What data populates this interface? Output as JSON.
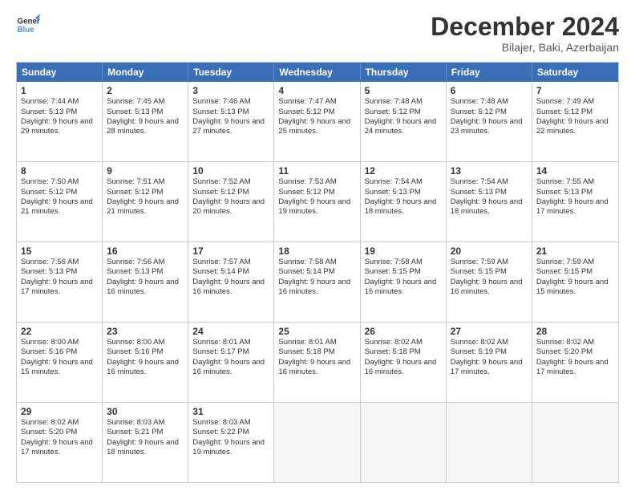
{
  "logo": {
    "general": "General",
    "blue": "Blue"
  },
  "title": "December 2024",
  "location": "Bilajer, Baki, Azerbaijan",
  "headers": [
    "Sunday",
    "Monday",
    "Tuesday",
    "Wednesday",
    "Thursday",
    "Friday",
    "Saturday"
  ],
  "weeks": [
    [
      {
        "day": "1",
        "sunrise": "Sunrise: 7:44 AM",
        "sunset": "Sunset: 5:13 PM",
        "daylight": "Daylight: 9 hours and 29 minutes."
      },
      {
        "day": "2",
        "sunrise": "Sunrise: 7:45 AM",
        "sunset": "Sunset: 5:13 PM",
        "daylight": "Daylight: 9 hours and 28 minutes."
      },
      {
        "day": "3",
        "sunrise": "Sunrise: 7:46 AM",
        "sunset": "Sunset: 5:13 PM",
        "daylight": "Daylight: 9 hours and 27 minutes."
      },
      {
        "day": "4",
        "sunrise": "Sunrise: 7:47 AM",
        "sunset": "Sunset: 5:12 PM",
        "daylight": "Daylight: 9 hours and 25 minutes."
      },
      {
        "day": "5",
        "sunrise": "Sunrise: 7:48 AM",
        "sunset": "Sunset: 5:12 PM",
        "daylight": "Daylight: 9 hours and 24 minutes."
      },
      {
        "day": "6",
        "sunrise": "Sunrise: 7:48 AM",
        "sunset": "Sunset: 5:12 PM",
        "daylight": "Daylight: 9 hours and 23 minutes."
      },
      {
        "day": "7",
        "sunrise": "Sunrise: 7:49 AM",
        "sunset": "Sunset: 5:12 PM",
        "daylight": "Daylight: 9 hours and 22 minutes."
      }
    ],
    [
      {
        "day": "8",
        "sunrise": "Sunrise: 7:50 AM",
        "sunset": "Sunset: 5:12 PM",
        "daylight": "Daylight: 9 hours and 21 minutes."
      },
      {
        "day": "9",
        "sunrise": "Sunrise: 7:51 AM",
        "sunset": "Sunset: 5:12 PM",
        "daylight": "Daylight: 9 hours and 21 minutes."
      },
      {
        "day": "10",
        "sunrise": "Sunrise: 7:52 AM",
        "sunset": "Sunset: 5:12 PM",
        "daylight": "Daylight: 9 hours and 20 minutes."
      },
      {
        "day": "11",
        "sunrise": "Sunrise: 7:53 AM",
        "sunset": "Sunset: 5:12 PM",
        "daylight": "Daylight: 9 hours and 19 minutes."
      },
      {
        "day": "12",
        "sunrise": "Sunrise: 7:54 AM",
        "sunset": "Sunset: 5:13 PM",
        "daylight": "Daylight: 9 hours and 18 minutes."
      },
      {
        "day": "13",
        "sunrise": "Sunrise: 7:54 AM",
        "sunset": "Sunset: 5:13 PM",
        "daylight": "Daylight: 9 hours and 18 minutes."
      },
      {
        "day": "14",
        "sunrise": "Sunrise: 7:55 AM",
        "sunset": "Sunset: 5:13 PM",
        "daylight": "Daylight: 9 hours and 17 minutes."
      }
    ],
    [
      {
        "day": "15",
        "sunrise": "Sunrise: 7:56 AM",
        "sunset": "Sunset: 5:13 PM",
        "daylight": "Daylight: 9 hours and 17 minutes."
      },
      {
        "day": "16",
        "sunrise": "Sunrise: 7:56 AM",
        "sunset": "Sunset: 5:13 PM",
        "daylight": "Daylight: 9 hours and 16 minutes."
      },
      {
        "day": "17",
        "sunrise": "Sunrise: 7:57 AM",
        "sunset": "Sunset: 5:14 PM",
        "daylight": "Daylight: 9 hours and 16 minutes."
      },
      {
        "day": "18",
        "sunrise": "Sunrise: 7:58 AM",
        "sunset": "Sunset: 5:14 PM",
        "daylight": "Daylight: 9 hours and 16 minutes."
      },
      {
        "day": "19",
        "sunrise": "Sunrise: 7:58 AM",
        "sunset": "Sunset: 5:15 PM",
        "daylight": "Daylight: 9 hours and 16 minutes."
      },
      {
        "day": "20",
        "sunrise": "Sunrise: 7:59 AM",
        "sunset": "Sunset: 5:15 PM",
        "daylight": "Daylight: 9 hours and 16 minutes."
      },
      {
        "day": "21",
        "sunrise": "Sunrise: 7:59 AM",
        "sunset": "Sunset: 5:15 PM",
        "daylight": "Daylight: 9 hours and 15 minutes."
      }
    ],
    [
      {
        "day": "22",
        "sunrise": "Sunrise: 8:00 AM",
        "sunset": "Sunset: 5:16 PM",
        "daylight": "Daylight: 9 hours and 15 minutes."
      },
      {
        "day": "23",
        "sunrise": "Sunrise: 8:00 AM",
        "sunset": "Sunset: 5:16 PM",
        "daylight": "Daylight: 9 hours and 16 minutes."
      },
      {
        "day": "24",
        "sunrise": "Sunrise: 8:01 AM",
        "sunset": "Sunset: 5:17 PM",
        "daylight": "Daylight: 9 hours and 16 minutes."
      },
      {
        "day": "25",
        "sunrise": "Sunrise: 8:01 AM",
        "sunset": "Sunset: 5:18 PM",
        "daylight": "Daylight: 9 hours and 16 minutes."
      },
      {
        "day": "26",
        "sunrise": "Sunrise: 8:02 AM",
        "sunset": "Sunset: 5:18 PM",
        "daylight": "Daylight: 9 hours and 16 minutes."
      },
      {
        "day": "27",
        "sunrise": "Sunrise: 8:02 AM",
        "sunset": "Sunset: 5:19 PM",
        "daylight": "Daylight: 9 hours and 17 minutes."
      },
      {
        "day": "28",
        "sunrise": "Sunrise: 8:02 AM",
        "sunset": "Sunset: 5:20 PM",
        "daylight": "Daylight: 9 hours and 17 minutes."
      }
    ],
    [
      {
        "day": "29",
        "sunrise": "Sunrise: 8:02 AM",
        "sunset": "Sunset: 5:20 PM",
        "daylight": "Daylight: 9 hours and 17 minutes."
      },
      {
        "day": "30",
        "sunrise": "Sunrise: 8:03 AM",
        "sunset": "Sunset: 5:21 PM",
        "daylight": "Daylight: 9 hours and 18 minutes."
      },
      {
        "day": "31",
        "sunrise": "Sunrise: 8:03 AM",
        "sunset": "Sunset: 5:22 PM",
        "daylight": "Daylight: 9 hours and 19 minutes."
      },
      null,
      null,
      null,
      null
    ]
  ]
}
